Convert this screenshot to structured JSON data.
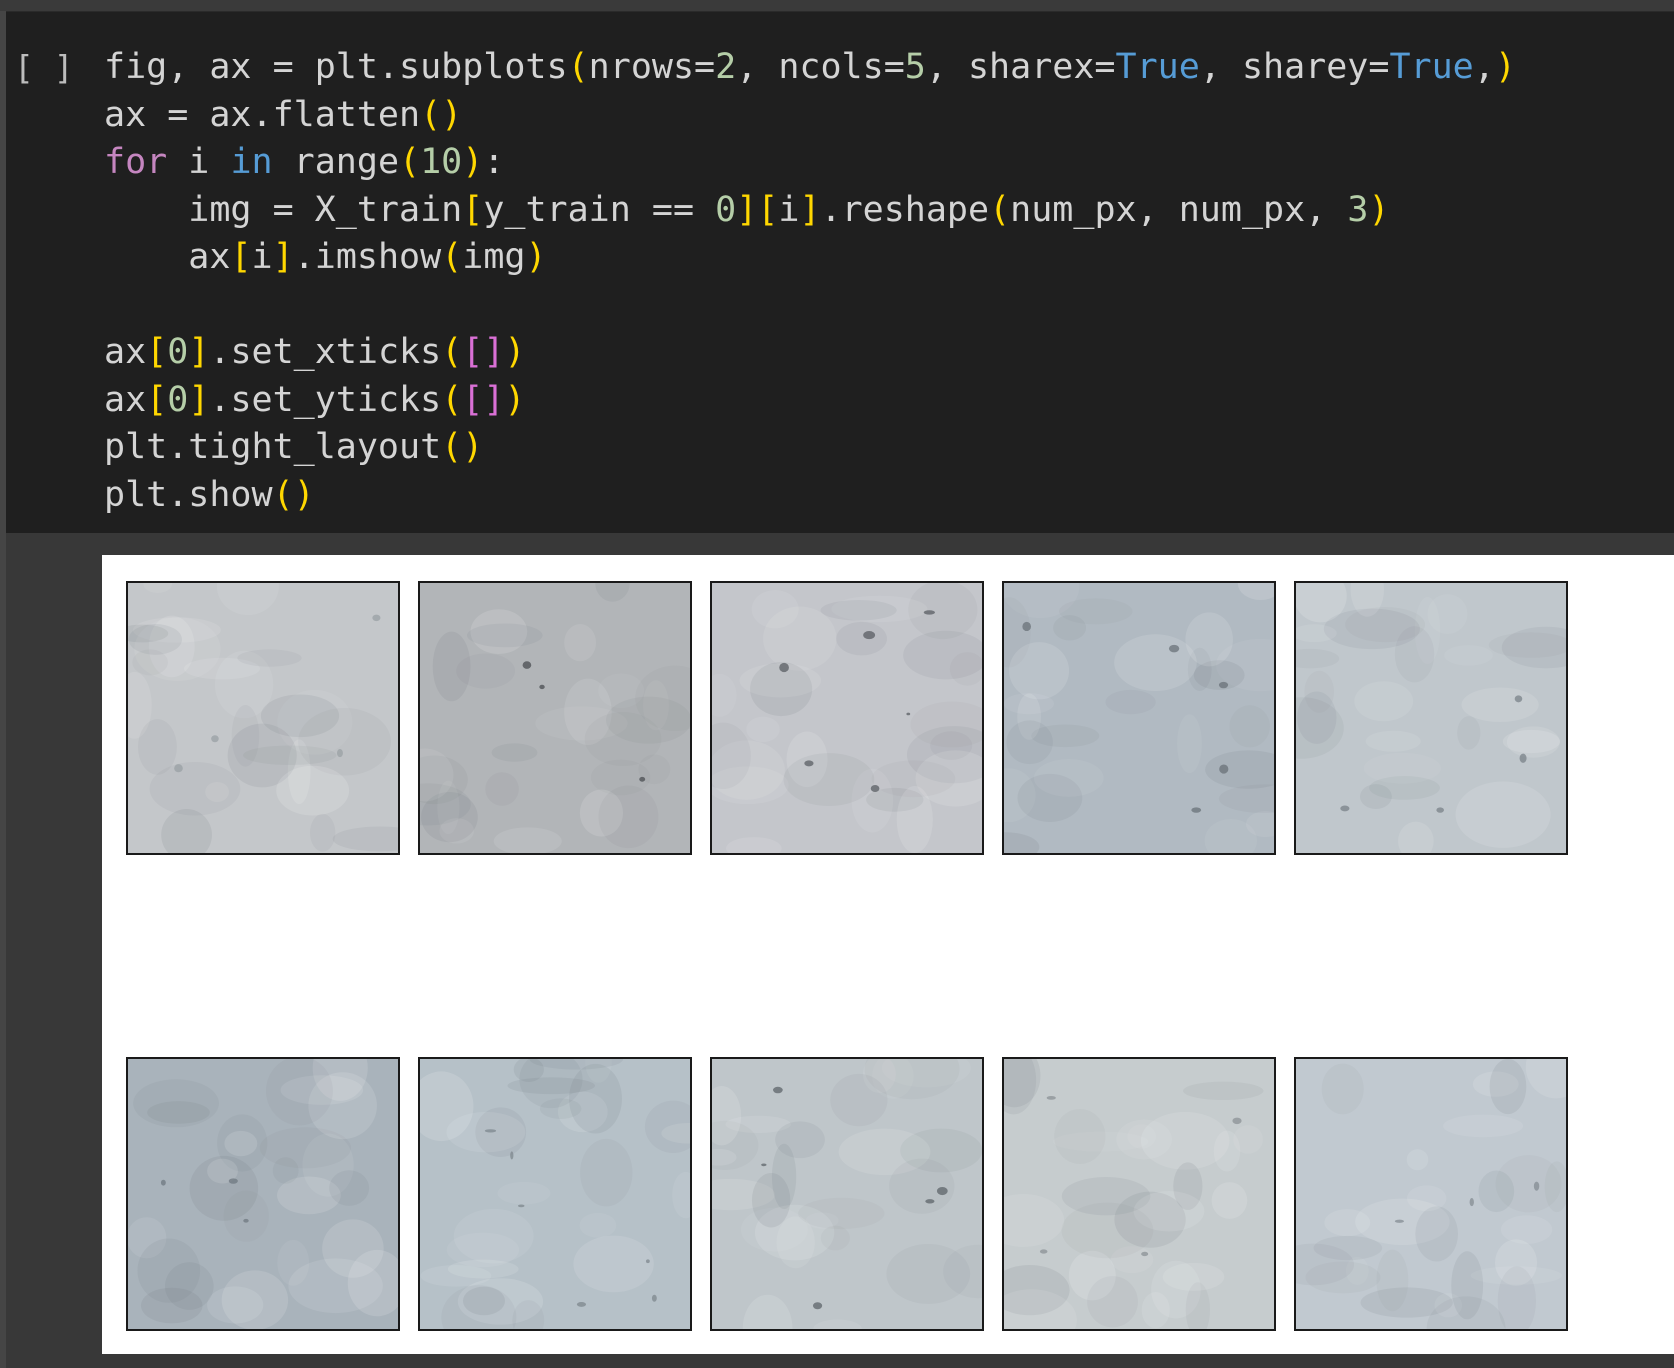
{
  "cell": {
    "run_indicator": "[ ]",
    "code_lines": [
      [
        {
          "t": "fig, ax = plt.subplots",
          "c": ""
        },
        {
          "t": "(",
          "c": "tk-bracket-y"
        },
        {
          "t": "nrows=",
          "c": ""
        },
        {
          "t": "2",
          "c": "tk-num"
        },
        {
          "t": ", ncols=",
          "c": ""
        },
        {
          "t": "5",
          "c": "tk-num"
        },
        {
          "t": ", sharex=",
          "c": ""
        },
        {
          "t": "True",
          "c": "tk-kw-blue"
        },
        {
          "t": ", sharey=",
          "c": ""
        },
        {
          "t": "True",
          "c": "tk-kw-blue"
        },
        {
          "t": ",",
          "c": ""
        },
        {
          "t": ")",
          "c": "tk-bracket-y"
        }
      ],
      [
        {
          "t": "ax = ax.flatten",
          "c": ""
        },
        {
          "t": "()",
          "c": "tk-bracket-y"
        }
      ],
      [
        {
          "t": "for",
          "c": "tk-kw-purple"
        },
        {
          "t": " i ",
          "c": ""
        },
        {
          "t": "in",
          "c": "tk-kw-blue"
        },
        {
          "t": " range",
          "c": ""
        },
        {
          "t": "(",
          "c": "tk-bracket-y"
        },
        {
          "t": "10",
          "c": "tk-num"
        },
        {
          "t": ")",
          "c": "tk-bracket-y"
        },
        {
          "t": ":",
          "c": ""
        }
      ],
      [
        {
          "t": "    img = X_train",
          "c": ""
        },
        {
          "t": "[",
          "c": "tk-bracket-y"
        },
        {
          "t": "y_train == ",
          "c": ""
        },
        {
          "t": "0",
          "c": "tk-num"
        },
        {
          "t": "]",
          "c": "tk-bracket-y"
        },
        {
          "t": "[",
          "c": "tk-bracket-y"
        },
        {
          "t": "i",
          "c": ""
        },
        {
          "t": "]",
          "c": "tk-bracket-y"
        },
        {
          "t": ".reshape",
          "c": ""
        },
        {
          "t": "(",
          "c": "tk-bracket-y"
        },
        {
          "t": "num_px, num_px, ",
          "c": ""
        },
        {
          "t": "3",
          "c": "tk-num"
        },
        {
          "t": ")",
          "c": "tk-bracket-y"
        }
      ],
      [
        {
          "t": "    ax",
          "c": ""
        },
        {
          "t": "[",
          "c": "tk-bracket-y"
        },
        {
          "t": "i",
          "c": ""
        },
        {
          "t": "]",
          "c": "tk-bracket-y"
        },
        {
          "t": ".imshow",
          "c": ""
        },
        {
          "t": "(",
          "c": "tk-bracket-y"
        },
        {
          "t": "img",
          "c": ""
        },
        {
          "t": ")",
          "c": "tk-bracket-y"
        }
      ],
      [],
      [
        {
          "t": "ax",
          "c": ""
        },
        {
          "t": "[",
          "c": "tk-bracket-y"
        },
        {
          "t": "0",
          "c": "tk-num"
        },
        {
          "t": "]",
          "c": "tk-bracket-y"
        },
        {
          "t": ".set_xticks",
          "c": ""
        },
        {
          "t": "(",
          "c": "tk-bracket-y"
        },
        {
          "t": "[]",
          "c": "tk-bracket-p"
        },
        {
          "t": ")",
          "c": "tk-bracket-y"
        }
      ],
      [
        {
          "t": "ax",
          "c": ""
        },
        {
          "t": "[",
          "c": "tk-bracket-y"
        },
        {
          "t": "0",
          "c": "tk-num"
        },
        {
          "t": "]",
          "c": "tk-bracket-y"
        },
        {
          "t": ".set_yticks",
          "c": ""
        },
        {
          "t": "(",
          "c": "tk-bracket-y"
        },
        {
          "t": "[]",
          "c": "tk-bracket-p"
        },
        {
          "t": ")",
          "c": "tk-bracket-y"
        }
      ],
      [
        {
          "t": "plt.tight_layout",
          "c": ""
        },
        {
          "t": "()",
          "c": "tk-bracket-y"
        }
      ],
      [
        {
          "t": "plt.show",
          "c": ""
        },
        {
          "t": "()",
          "c": "tk-bracket-y"
        }
      ]
    ]
  },
  "output": {
    "grid": {
      "rows": 2,
      "cols": 5
    },
    "images": [
      {
        "index": 0,
        "base_color": "#c4c7ca",
        "speck_color": "#9aa0a4"
      },
      {
        "index": 1,
        "base_color": "#b2b5b8",
        "speck_color": "#4a4e52"
      },
      {
        "index": 2,
        "base_color": "#c4c6cb",
        "speck_color": "#5a5e63"
      },
      {
        "index": 3,
        "base_color": "#b1bac2",
        "speck_color": "#6a7278"
      },
      {
        "index": 4,
        "base_color": "#c0c7cc",
        "speck_color": "#7a8288"
      },
      {
        "index": 5,
        "base_color": "#a9b3bb",
        "speck_color": "#6f7880"
      },
      {
        "index": 6,
        "base_color": "#b6c1c8",
        "speck_color": "#7d878e"
      },
      {
        "index": 7,
        "base_color": "#bfc6ca",
        "speck_color": "#5d6469"
      },
      {
        "index": 8,
        "base_color": "#c6ccce",
        "speck_color": "#8b9296"
      },
      {
        "index": 9,
        "base_color": "#c1c9d0",
        "speck_color": "#848c93"
      }
    ]
  }
}
